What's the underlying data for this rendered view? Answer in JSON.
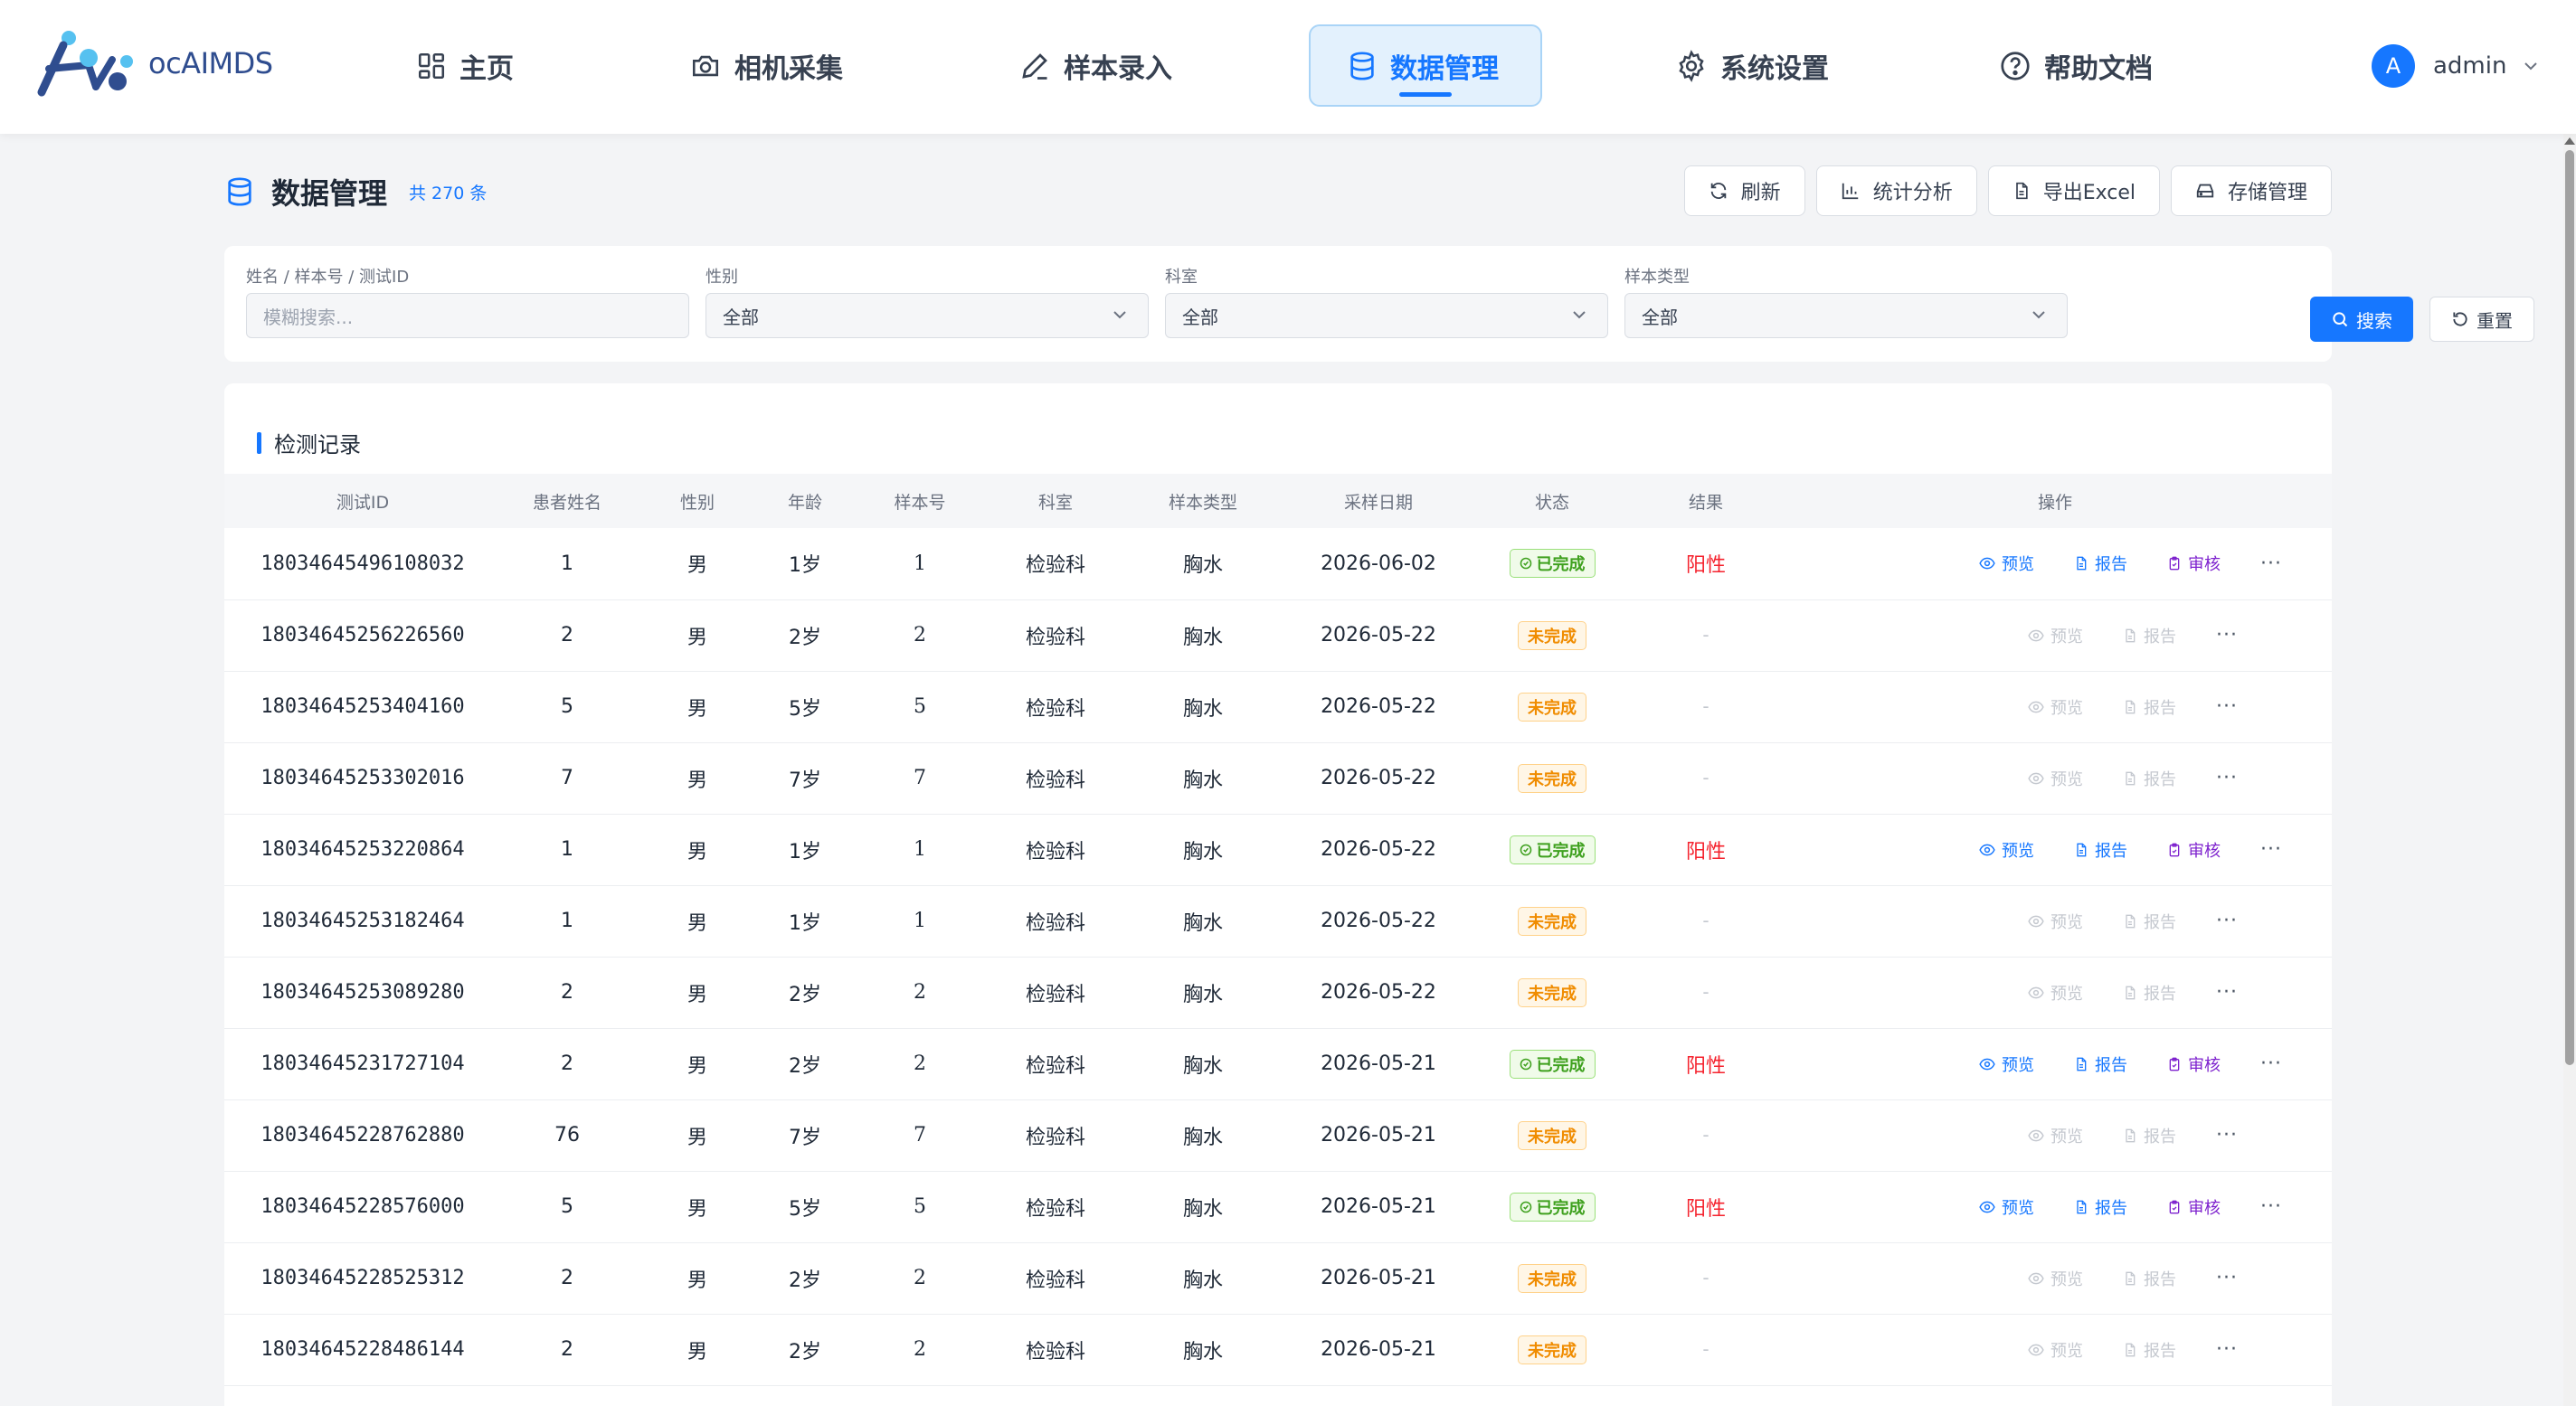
{
  "app": {
    "logo_text": "ocAIMDS"
  },
  "nav": [
    {
      "label": "主页",
      "icon": "grid-icon"
    },
    {
      "label": "相机采集",
      "icon": "camera-icon"
    },
    {
      "label": "样本录入",
      "icon": "pencil-icon"
    },
    {
      "label": "数据管理",
      "icon": "database-icon",
      "active": true
    },
    {
      "label": "系统设置",
      "icon": "gear-icon"
    },
    {
      "label": "帮助文档",
      "icon": "help-icon"
    }
  ],
  "user": {
    "avatar_letter": "A",
    "name": "admin"
  },
  "page": {
    "title": "数据管理",
    "count": "共 270 条"
  },
  "toolbar": {
    "refresh": "刷新",
    "stats": "统计分析",
    "export": "导出Excel",
    "storage": "存储管理"
  },
  "filters": {
    "keyword": {
      "label": "姓名 / 样本号 / 测试ID",
      "placeholder": "模糊搜索...",
      "value": ""
    },
    "gender": {
      "label": "性别",
      "value": "全部"
    },
    "department": {
      "label": "科室",
      "value": "全部"
    },
    "sample_type": {
      "label": "样本类型",
      "value": "全部"
    },
    "search_label": "搜索",
    "reset_label": "重置"
  },
  "records": {
    "title": "检测记录",
    "columns": [
      "测试ID",
      "患者姓名",
      "性别",
      "年龄",
      "样本号",
      "科室",
      "样本类型",
      "采样日期",
      "状态",
      "结果",
      "操作"
    ],
    "actions": {
      "preview": "预览",
      "report": "报告",
      "review": "审核",
      "more": "···"
    },
    "rows": [
      {
        "id": "18034645496108032",
        "name": "1",
        "gender": "男",
        "age": "1岁",
        "sample": "1",
        "dept": "检验科",
        "type": "胸水",
        "date": "2026-06-02",
        "status": "已完成",
        "done": true,
        "result": "阳性"
      },
      {
        "id": "18034645256226560",
        "name": "2",
        "gender": "男",
        "age": "2岁",
        "sample": "2",
        "dept": "检验科",
        "type": "胸水",
        "date": "2026-05-22",
        "status": "未完成",
        "done": false,
        "result": "-"
      },
      {
        "id": "18034645253404160",
        "name": "5",
        "gender": "男",
        "age": "5岁",
        "sample": "5",
        "dept": "检验科",
        "type": "胸水",
        "date": "2026-05-22",
        "status": "未完成",
        "done": false,
        "result": "-"
      },
      {
        "id": "18034645253302016",
        "name": "7",
        "gender": "男",
        "age": "7岁",
        "sample": "7",
        "dept": "检验科",
        "type": "胸水",
        "date": "2026-05-22",
        "status": "未完成",
        "done": false,
        "result": "-"
      },
      {
        "id": "18034645253220864",
        "name": "1",
        "gender": "男",
        "age": "1岁",
        "sample": "1",
        "dept": "检验科",
        "type": "胸水",
        "date": "2026-05-22",
        "status": "已完成",
        "done": true,
        "result": "阳性"
      },
      {
        "id": "18034645253182464",
        "name": "1",
        "gender": "男",
        "age": "1岁",
        "sample": "1",
        "dept": "检验科",
        "type": "胸水",
        "date": "2026-05-22",
        "status": "未完成",
        "done": false,
        "result": "-"
      },
      {
        "id": "18034645253089280",
        "name": "2",
        "gender": "男",
        "age": "2岁",
        "sample": "2",
        "dept": "检验科",
        "type": "胸水",
        "date": "2026-05-22",
        "status": "未完成",
        "done": false,
        "result": "-"
      },
      {
        "id": "18034645231727104",
        "name": "2",
        "gender": "男",
        "age": "2岁",
        "sample": "2",
        "dept": "检验科",
        "type": "胸水",
        "date": "2026-05-21",
        "status": "已完成",
        "done": true,
        "result": "阳性"
      },
      {
        "id": "18034645228762880",
        "name": "76",
        "gender": "男",
        "age": "7岁",
        "sample": "7",
        "dept": "检验科",
        "type": "胸水",
        "date": "2026-05-21",
        "status": "未完成",
        "done": false,
        "result": "-"
      },
      {
        "id": "18034645228576000",
        "name": "5",
        "gender": "男",
        "age": "5岁",
        "sample": "5",
        "dept": "检验科",
        "type": "胸水",
        "date": "2026-05-21",
        "status": "已完成",
        "done": true,
        "result": "阳性"
      },
      {
        "id": "18034645228525312",
        "name": "2",
        "gender": "男",
        "age": "2岁",
        "sample": "2",
        "dept": "检验科",
        "type": "胸水",
        "date": "2026-05-21",
        "status": "未完成",
        "done": false,
        "result": "-"
      },
      {
        "id": "18034645228486144",
        "name": "2",
        "gender": "男",
        "age": "2岁",
        "sample": "2",
        "dept": "检验科",
        "type": "胸水",
        "date": "2026-05-21",
        "status": "未完成",
        "done": false,
        "result": "-"
      }
    ]
  },
  "colors": {
    "primary": "#1677ff",
    "success": "#3fa11f",
    "warning": "#f08c00",
    "danger": "#f5222d",
    "review": "#7e22ce"
  }
}
